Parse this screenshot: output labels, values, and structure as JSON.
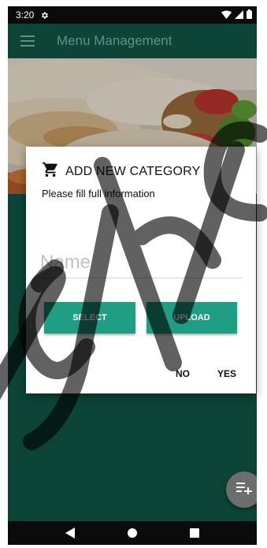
{
  "status_bar": {
    "time": "3:20"
  },
  "app_bar": {
    "title": "Menu Management"
  },
  "dialog": {
    "title": "ADD NEW CATEGORY",
    "subtitle": "Please fill full information",
    "name_placeholder": "Name",
    "select_label": "SELECT",
    "upload_label": "UPLOAD",
    "no_label": "NO",
    "yes_label": "YES"
  },
  "colors": {
    "primary": "#0f5546",
    "accent": "#1f9e84",
    "fab": "#6d6d6d"
  },
  "icons": [
    "gear-icon",
    "wifi-icon",
    "signal-icon",
    "battery-icon",
    "hamburger-menu-icon",
    "cart-icon",
    "playlist-add-icon",
    "back-icon",
    "home-icon",
    "recents-icon"
  ]
}
